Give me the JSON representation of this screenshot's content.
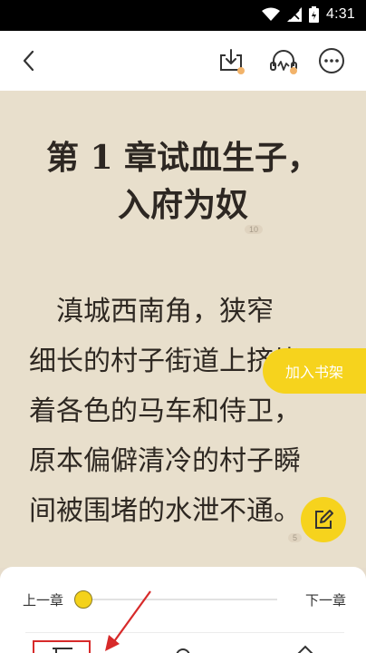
{
  "status_bar": {
    "time": "4:31"
  },
  "chapter": {
    "title_lines": [
      "第 1 章试血生子，",
      "入府为奴"
    ],
    "page_top": "10",
    "page_bottom": "5",
    "lines": [
      "　滇城西南角，狭窄",
      "细长的村子街道上挤堵",
      "着各色的马车和侍卫，",
      "原本偏僻清冷的村子瞬",
      "间被围堵的水泄不通。"
    ]
  },
  "add_shelf": {
    "label": "加入书架"
  },
  "controls": {
    "prev_chapter": "上一章",
    "next_chapter": "下一章",
    "progress": 0.0
  },
  "colors": {
    "accent": "#f6d31d",
    "notice_dot": "#f2b36a",
    "highlight": "#d72a2a"
  },
  "icons": [
    "back-icon",
    "download-icon",
    "listen-icon",
    "more-icon",
    "edit-note-icon",
    "wifi-icon",
    "signal-icon",
    "battery-icon",
    "catalog-icon"
  ]
}
